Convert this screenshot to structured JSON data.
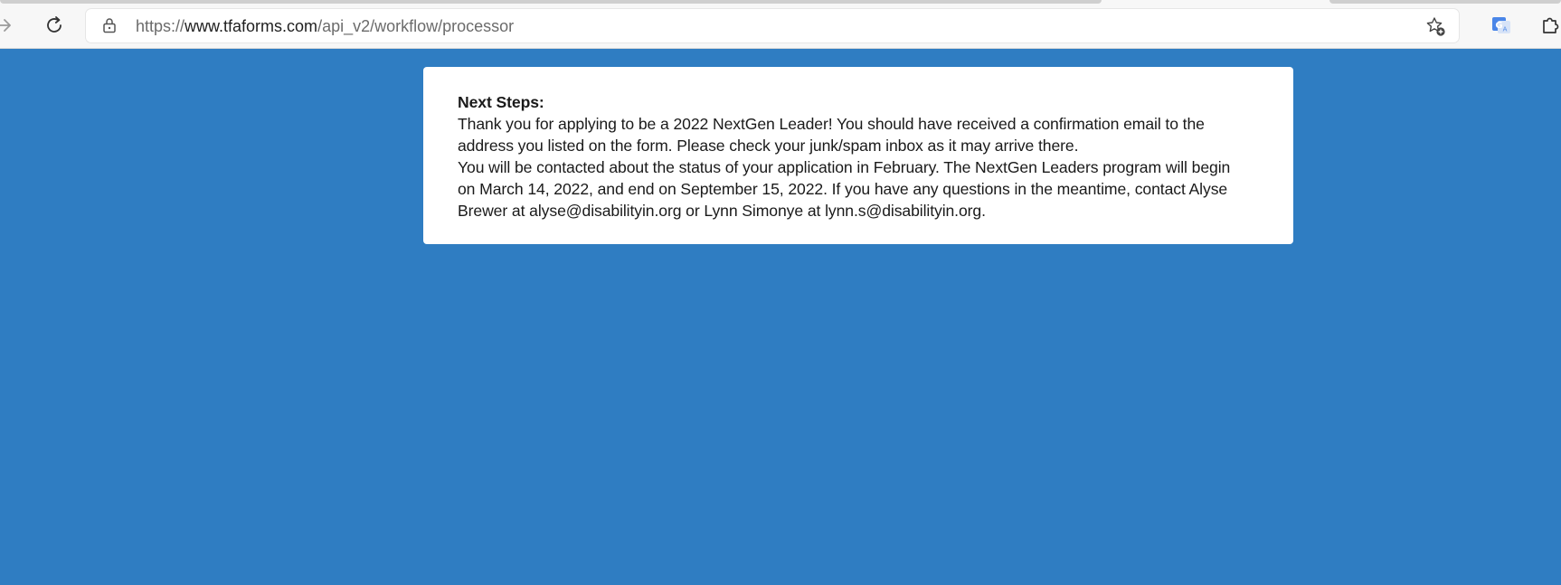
{
  "browser": {
    "url_scheme": "https://",
    "url_host": "www.tfaforms.com",
    "url_path": "/api_v2/workflow/processor",
    "icons": [
      "forward-icon",
      "reload-icon",
      "lock-icon",
      "favorite-add-icon",
      "translate-icon",
      "extensions-icon"
    ]
  },
  "card": {
    "heading": "Next Steps:",
    "line1": "Thank you for applying to be a 2022 NextGen Leader! You should have received a confirmation email to the",
    "line2": "address you listed on the form. Please check your junk/spam inbox as it may arrive there.",
    "line3": "You will be contacted about the status of your application in February. The NextGen Leaders program will begin",
    "line4": "on March 14, 2022, and end on September 15, 2022. If you have any questions in the meantime, contact Alyse",
    "line5": "Brewer at alyse@disabilityin.org or Lynn Simonye at lynn.s@disabilityin.org."
  },
  "colors": {
    "page_background": "#2f7dc2",
    "card_background": "#ffffff",
    "toolbar_background": "#f7f7f7"
  }
}
